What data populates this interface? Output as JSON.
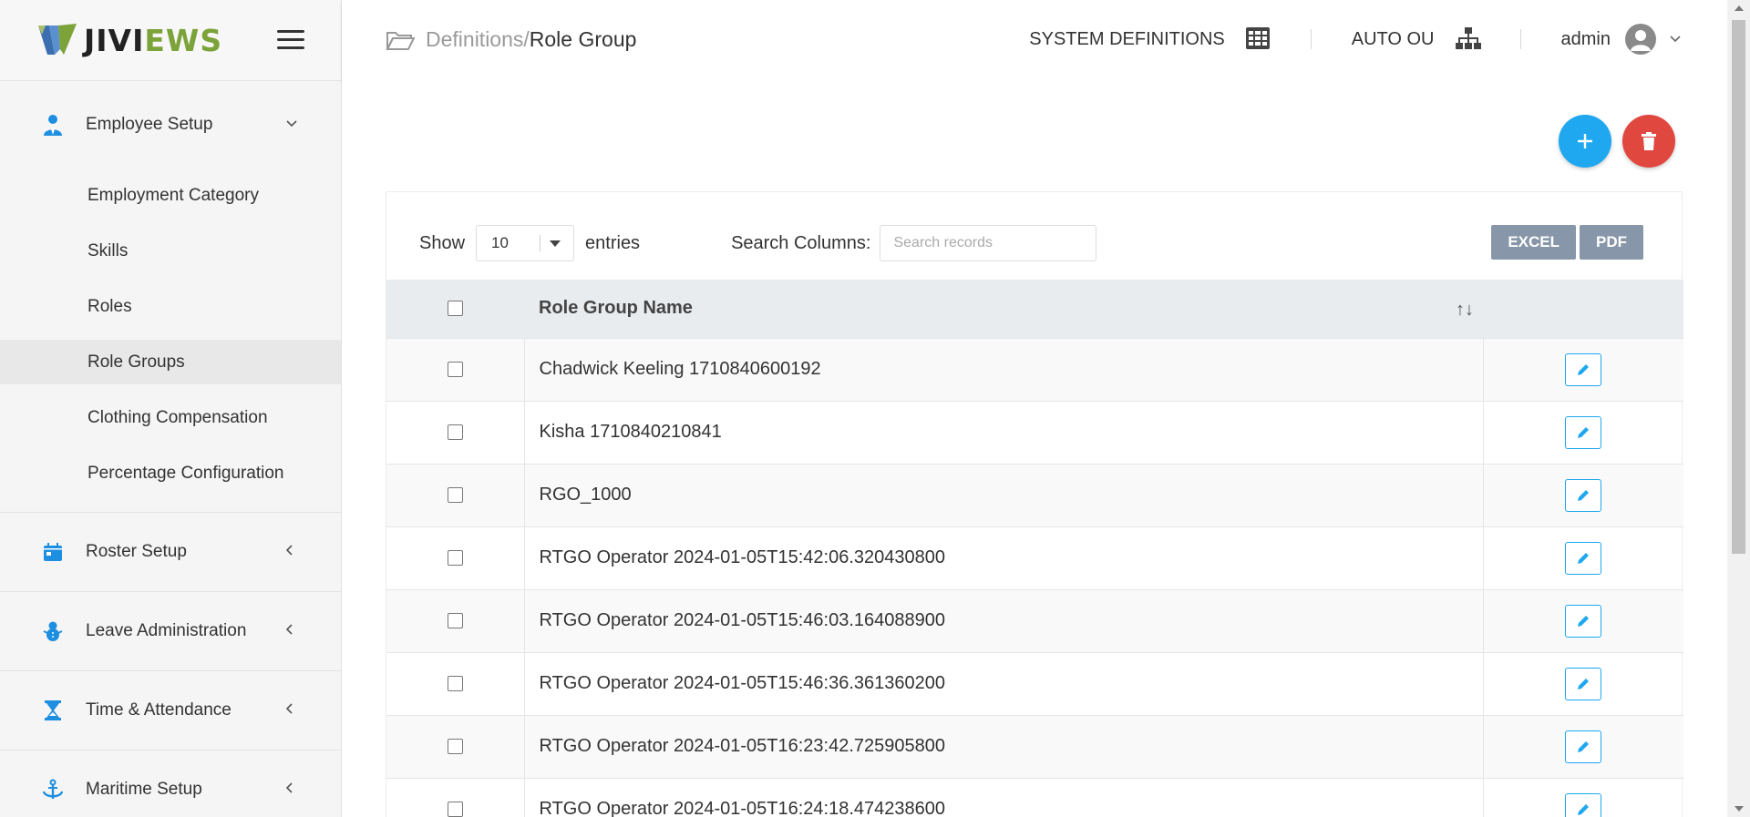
{
  "brand": {
    "part1": "JIVI",
    "part2": "EWS"
  },
  "breadcrumb": {
    "parent": "Definitions/",
    "current": "Role Group"
  },
  "topbar": {
    "system_definitions": "SYSTEM DEFINITIONS",
    "auto_ou": "AUTO OU",
    "user": "admin"
  },
  "sidebar": {
    "employee_setup": "Employee Setup",
    "sub_items": [
      "Employment Category",
      "Skills",
      "Roles",
      "Role Groups",
      "Clothing Compensation",
      "Percentage Configuration"
    ],
    "roster_setup": "Roster Setup",
    "leave_administration": "Leave Administration",
    "time_attendance": "Time & Attendance",
    "maritime_setup": "Maritime Setup"
  },
  "controls": {
    "show_label": "Show",
    "entries_value": "10",
    "entries_label": "entries",
    "search_label": "Search Columns:",
    "search_placeholder": "Search records",
    "excel": "EXCEL",
    "pdf": "PDF"
  },
  "table": {
    "header": "Role Group Name",
    "rows": [
      "Chadwick Keeling 1710840600192",
      "Kisha 1710840210841",
      "RGO_1000",
      "RTGO Operator 2024-01-05T15:42:06.320430800",
      "RTGO Operator 2024-01-05T15:46:03.164088900",
      "RTGO Operator 2024-01-05T15:46:36.361360200",
      "RTGO Operator 2024-01-05T16:23:42.725905800",
      "RTGO Operator 2024-01-05T16:24:18.474238600"
    ]
  },
  "colors": {
    "primary": "#1fa7f0",
    "danger": "#e0473f",
    "brand_green": "#7ca23a",
    "export_btn": "#8796a8"
  },
  "icons": [
    "hamburger-icon",
    "folder-icon",
    "grid-icon",
    "sitemap-icon",
    "user-avatar-icon",
    "plus-icon",
    "trash-icon",
    "pencil-icon",
    "sort-icon"
  ]
}
